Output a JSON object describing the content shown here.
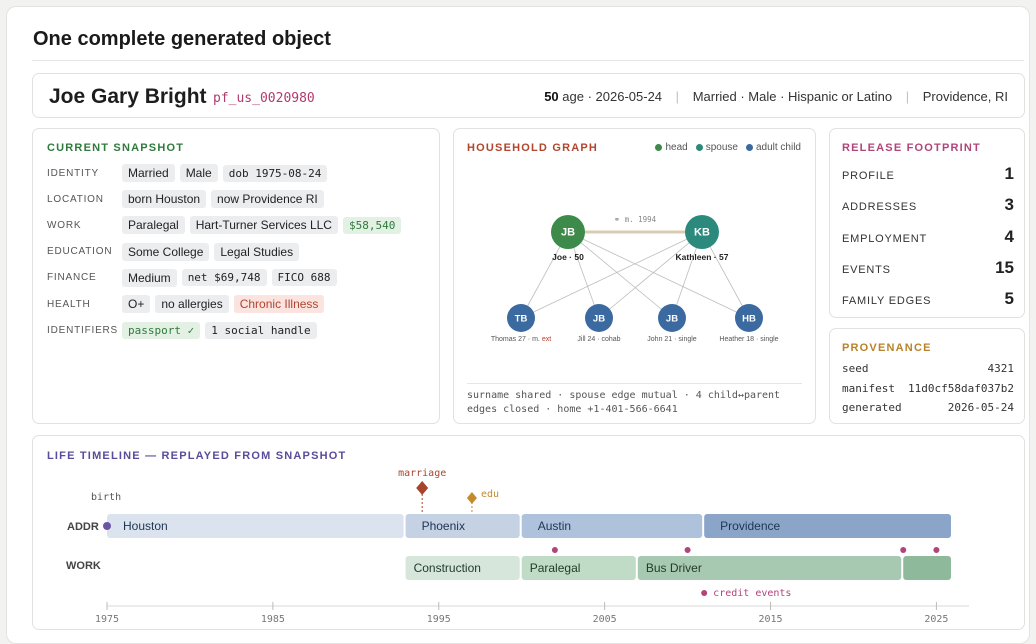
{
  "page": {
    "title": "One complete generated object"
  },
  "header": {
    "name": "Joe Gary Bright",
    "id": "pf_us_0020980",
    "age": "50",
    "age_text": "age · 2026-05-24",
    "demographics": "Married · Male · Hispanic or Latino",
    "location": "Providence, RI"
  },
  "snapshot": {
    "title": "CURRENT SNAPSHOT",
    "rows": [
      {
        "label": "IDENTITY",
        "chips": [
          "Married",
          "Male",
          "dob 1975-08-24"
        ]
      },
      {
        "label": "LOCATION",
        "chips": [
          "born Houston",
          "now Providence RI"
        ]
      },
      {
        "label": "WORK",
        "chips": [
          "Paralegal",
          "Hart-Turner Services LLC",
          "$58,540"
        ]
      },
      {
        "label": "EDUCATION",
        "chips": [
          "Some College",
          "Legal Studies"
        ]
      },
      {
        "label": "FINANCE",
        "chips": [
          "Medium",
          "net $69,748",
          "FICO 688"
        ]
      },
      {
        "label": "HEALTH",
        "chips": [
          "O+",
          "no allergies",
          "Chronic Illness"
        ]
      },
      {
        "label": "IDENTIFIERS",
        "chips": [
          "passport ✓",
          "1 social handle"
        ]
      }
    ]
  },
  "household": {
    "title": "HOUSEHOLD GRAPH",
    "legend": [
      "head",
      "spouse",
      "adult child"
    ],
    "edge_label": "⚭ m. 1994",
    "nodes": [
      {
        "initials": "JB",
        "caption": "Joe · 50",
        "role": "head"
      },
      {
        "initials": "KB",
        "caption": "Kathleen · 57",
        "role": "spouse"
      },
      {
        "initials": "TB",
        "caption": "Thomas 27 · m. ",
        "caption_extra": "ext",
        "role": "child"
      },
      {
        "initials": "JB",
        "caption": "Jill 24 · cohab",
        "role": "child"
      },
      {
        "initials": "JB",
        "caption": "John 21 · single",
        "role": "child"
      },
      {
        "initials": "HB",
        "caption": "Heather 18 · single",
        "role": "child"
      }
    ],
    "footer_line1": "surname shared · spouse edge mutual · 4 child↔parent",
    "footer_line2": "edges closed · home +1-401-566-6641"
  },
  "release": {
    "title": "RELEASE FOOTPRINT",
    "rows": [
      {
        "label": "PROFILE",
        "value": "1"
      },
      {
        "label": "ADDRESSES",
        "value": "3"
      },
      {
        "label": "EMPLOYMENT",
        "value": "4"
      },
      {
        "label": "EVENTS",
        "value": "15"
      },
      {
        "label": "FAMILY EDGES",
        "value": "5"
      }
    ]
  },
  "provenance": {
    "title": "PROVENANCE",
    "rows": [
      {
        "label": "seed",
        "value": "4321"
      },
      {
        "label": "manifest",
        "value": "11d0cf58daf037b2"
      },
      {
        "label": "generated",
        "value": "2026-05-24"
      }
    ]
  },
  "timeline": {
    "title": "LIFE TIMELINE — REPLAYED FROM SNAPSHOT",
    "row_labels": [
      "ADDR",
      "WORK"
    ],
    "axis": {
      "min": 1975,
      "max": 2026,
      "ticks": [
        1975,
        1985,
        1995,
        2005,
        2015,
        2025
      ]
    },
    "addr": [
      {
        "label": "Houston",
        "start": 1975,
        "end": 1993
      },
      {
        "label": "Phoenix",
        "start": 1993,
        "end": 2000
      },
      {
        "label": "Austin",
        "start": 2000,
        "end": 2011
      },
      {
        "label": "Providence",
        "start": 2011,
        "end": 2026
      }
    ],
    "work": [
      {
        "label": "Construction",
        "start": 1993,
        "end": 2000
      },
      {
        "label": "Paralegal",
        "start": 2000,
        "end": 2007
      },
      {
        "label": "Bus Driver",
        "start": 2007,
        "end": 2023
      },
      {
        "label": "",
        "start": 2023,
        "end": 2026
      }
    ],
    "events": [
      {
        "label": "birth",
        "year": 1975
      },
      {
        "label": "marriage",
        "year": 1994
      },
      {
        "label": "edu",
        "year": 1997
      }
    ],
    "credit_years": [
      2002,
      2010,
      2023,
      2025
    ],
    "credit_label": "credit events",
    "colors": {
      "houston": "#dbe3ee",
      "phoenix": "#c4d2e4",
      "austin": "#aec2dc",
      "providence": "#8aa5c8",
      "construction": "#d6e6da",
      "paralegal": "#c0dcc7",
      "busdriver": "#a8c9b1",
      "last": "#8fb99b",
      "marriage": "#a6452e",
      "edu": "#c58a2a",
      "birth": "#6b56a6",
      "credit": "#b0457a"
    }
  }
}
